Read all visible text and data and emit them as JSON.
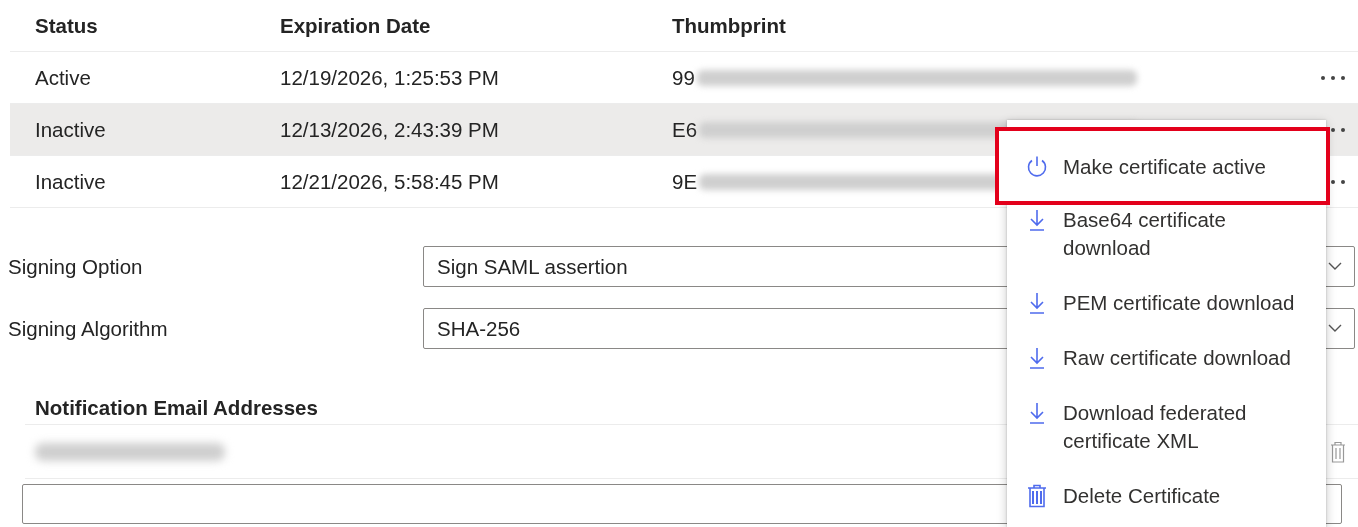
{
  "table": {
    "columns": [
      "Status",
      "Expiration Date",
      "Thumbprint"
    ],
    "rows": [
      {
        "status": "Active",
        "expiration": "12/19/2026, 1:25:53 PM",
        "thumbprint": "99",
        "selected": false
      },
      {
        "status": "Inactive",
        "expiration": "12/13/2026, 2:43:39 PM",
        "thumbprint": "E6",
        "selected": true
      },
      {
        "status": "Inactive",
        "expiration": "12/21/2026, 5:58:45 PM",
        "thumbprint": "9E",
        "selected": false
      }
    ]
  },
  "form": [
    {
      "label": "Signing Option",
      "value": "Sign SAML assertion"
    },
    {
      "label": "Signing Algorithm",
      "value": "SHA-256"
    }
  ],
  "notification": {
    "title": "Notification Email Addresses"
  },
  "menu": {
    "items": [
      {
        "kind": "activate",
        "label": "Make certificate active",
        "highlighted": true
      },
      {
        "kind": "download",
        "label": "Base64 certificate download",
        "highlighted": false
      },
      {
        "kind": "download",
        "label": "PEM certificate download",
        "highlighted": false
      },
      {
        "kind": "download",
        "label": "Raw certificate download",
        "highlighted": false
      },
      {
        "kind": "download",
        "label": "Download federated certificate XML",
        "highlighted": false
      },
      {
        "kind": "delete",
        "label": "Delete Certificate",
        "highlighted": false
      }
    ]
  }
}
